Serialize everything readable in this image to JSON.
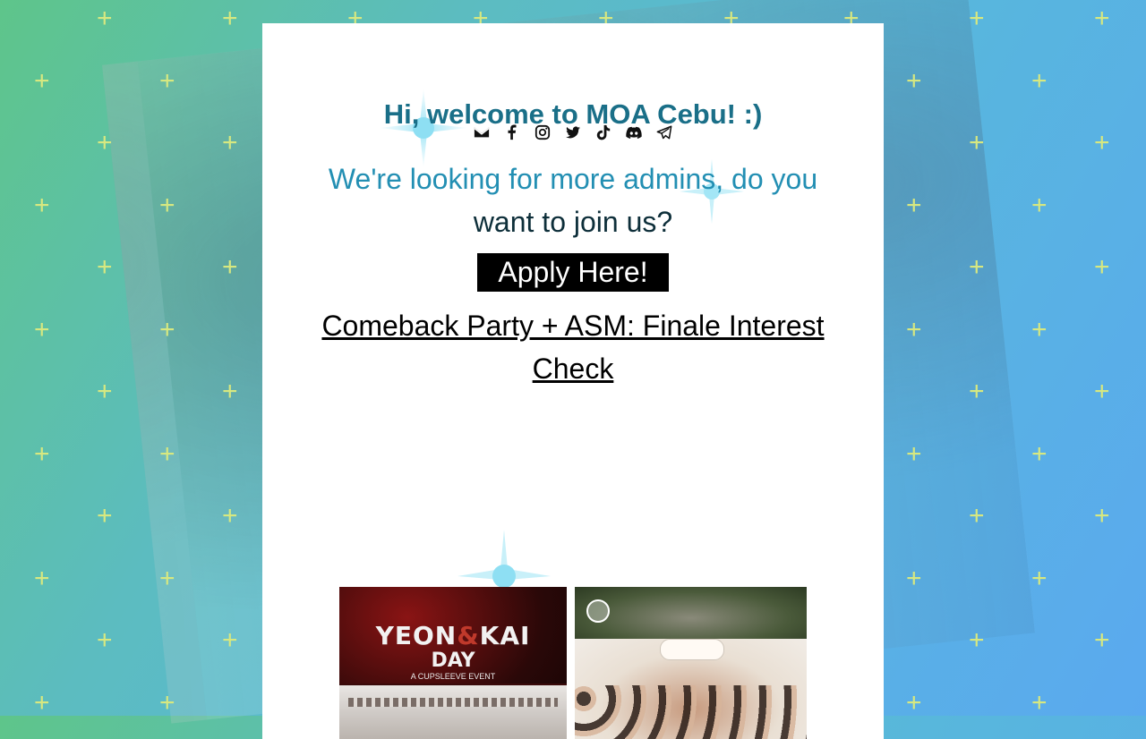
{
  "welcome": {
    "text": "Hi, welcome to MOA Cebu! :)"
  },
  "socials": [
    {
      "name": "email-icon"
    },
    {
      "name": "facebook-icon"
    },
    {
      "name": "instagram-icon"
    },
    {
      "name": "twitter-icon"
    },
    {
      "name": "tiktok-icon"
    },
    {
      "name": "discord-icon"
    },
    {
      "name": "telegram-icon"
    }
  ],
  "recruit": {
    "line1": "We're looking for more admins, do you",
    "line2": "want to join us?"
  },
  "apply_button": {
    "label": "Apply Here!"
  },
  "event_link": {
    "text": "Comeback Party + ASM: Finale Interest Check"
  },
  "thumbnails": [
    {
      "title_left": "YEON",
      "amp": "&",
      "title_right": "KAI",
      "title_line2": "DAY",
      "subtitle": "A CUPSLEEVE EVENT"
    },
    {
      "title": ""
    }
  ],
  "colors": {
    "welcome": "#1a6f88",
    "recruit": "#238fb3",
    "button_bg": "#000000",
    "plus": "#d7e880"
  }
}
